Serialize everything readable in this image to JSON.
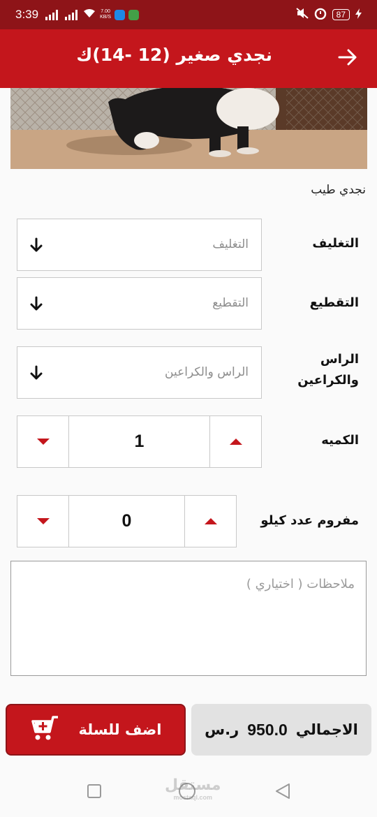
{
  "status_bar": {
    "time": "3:39",
    "net_speed_value": "7.00",
    "net_speed_unit": "KB/S",
    "battery": "87"
  },
  "app_bar": {
    "title": "نجدي صغير (12 -14)ك",
    "back_icon": "arrow-right-icon"
  },
  "product": {
    "description": "نجدي طيب"
  },
  "options": {
    "packaging": {
      "label": "التغليف",
      "placeholder": "التغليف"
    },
    "cutting": {
      "label": "التقطيع",
      "placeholder": "التقطيع"
    },
    "head_legs": {
      "label": "الراس والكراعين",
      "placeholder": "الراس والكراعين"
    }
  },
  "quantity": {
    "label": "الكميه",
    "value": "1"
  },
  "minced": {
    "label": "مفروم عدد كيلو",
    "value": "0"
  },
  "notes": {
    "placeholder": "ملاحظات ( اختياري )"
  },
  "footer": {
    "total_label": "الاجمالي",
    "total_value": "950.0",
    "currency": "ر.س",
    "add_to_cart": "اضف للسلة"
  },
  "watermark": {
    "text": "مستقل",
    "sub": "mostaql.com"
  },
  "colors": {
    "primary": "#c4161c",
    "status_bar": "#8e1418",
    "total_bg": "#e2e2e2"
  }
}
